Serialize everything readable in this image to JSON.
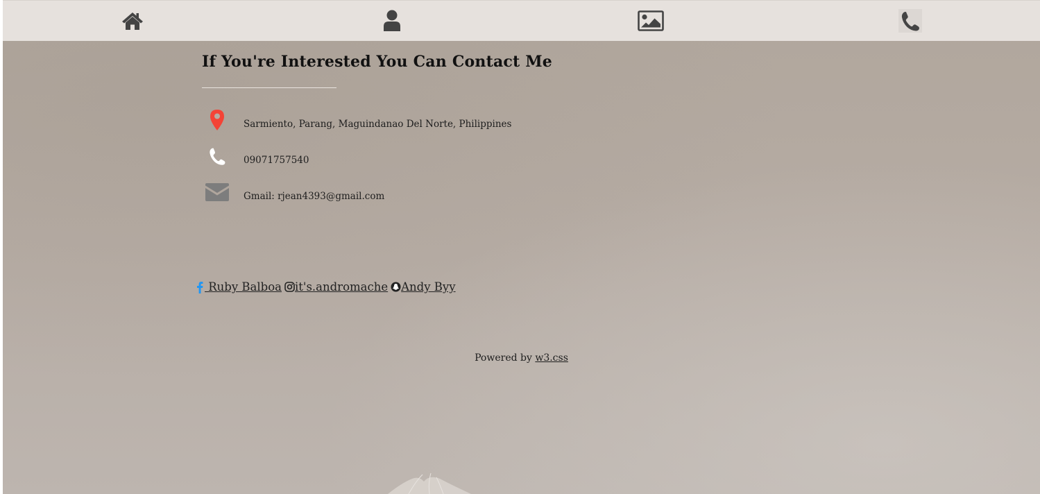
{
  "nav": {
    "items": [
      {
        "icon": "home-icon",
        "name": "home"
      },
      {
        "icon": "user-icon",
        "name": "about"
      },
      {
        "icon": "image-icon",
        "name": "photos"
      },
      {
        "icon": "phone-icon",
        "name": "contact"
      }
    ]
  },
  "contact": {
    "title": "If You're Interested You Can Contact Me",
    "address": "Sarmiento, Parang, Maguindanao Del Norte, Philippines",
    "phone": "09071757540",
    "email": "Gmail: rjean4393@gmail.com"
  },
  "social": {
    "facebook": " Ruby Balboa",
    "instagram": "it's.andromache",
    "snapchat": "Andy Byy"
  },
  "footer": {
    "powered_by": "Powered by ",
    "link": "w3.css"
  },
  "colors": {
    "nav_bg": "#e6e1dd",
    "icon_dark": "#444444",
    "pin_red": "#f44336",
    "facebook_blue": "#2196f3",
    "mail_gray": "#7d7d7d"
  }
}
